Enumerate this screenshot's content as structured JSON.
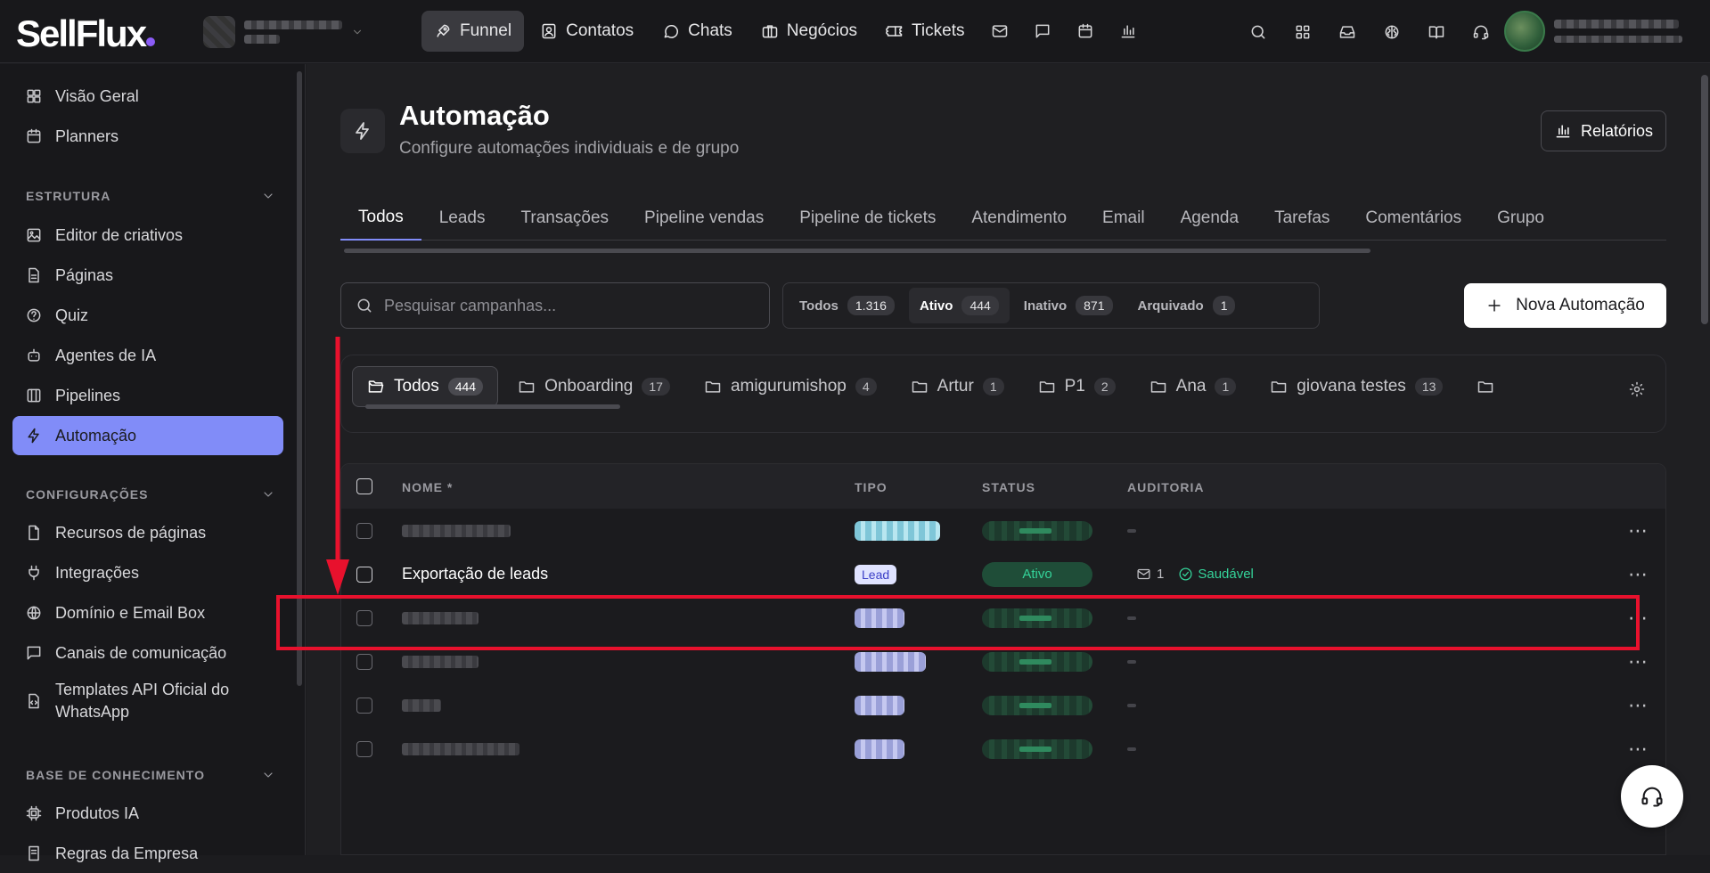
{
  "app": {
    "logo": "SellFlux"
  },
  "topnav": [
    {
      "label": "Funnel",
      "icon": "rocket-icon",
      "active": true
    },
    {
      "label": "Contatos",
      "icon": "contacts-icon"
    },
    {
      "label": "Chats",
      "icon": "chat-icon"
    },
    {
      "label": "Negócios",
      "icon": "briefcase-icon"
    },
    {
      "label": "Tickets",
      "icon": "ticket-icon"
    }
  ],
  "sidebar": {
    "top_items": [
      {
        "label": "Visão Geral",
        "icon": "dashboard-icon"
      },
      {
        "label": "Planners",
        "icon": "calendar-icon"
      }
    ],
    "sections": {
      "estrutura": "ESTRUTURA",
      "configuracoes": "CONFIGURAÇÕES",
      "base": "BASE DE CONHECIMENTO"
    },
    "estrutura_items": [
      {
        "label": "Editor de criativos",
        "icon": "image-edit-icon"
      },
      {
        "label": "Páginas",
        "icon": "page-icon"
      },
      {
        "label": "Quiz",
        "icon": "help-circle-icon"
      },
      {
        "label": "Agentes de IA",
        "icon": "bot-icon"
      },
      {
        "label": "Pipelines",
        "icon": "pipeline-icon"
      },
      {
        "label": "Automação",
        "icon": "zap-icon",
        "active": true
      }
    ],
    "config_items": [
      {
        "label": "Recursos de páginas",
        "icon": "file-icon"
      },
      {
        "label": "Integrações",
        "icon": "plug-icon"
      },
      {
        "label": "Domínio e Email Box",
        "icon": "globe-icon"
      },
      {
        "label": "Canais de comunicação",
        "icon": "message-square-icon"
      },
      {
        "label_line1": "Templates API Oficial do",
        "label_line2": "WhatsApp",
        "icon": "file-code-icon"
      }
    ],
    "base_items": [
      {
        "label": "Produtos IA",
        "icon": "cpu-icon"
      },
      {
        "label": "Regras da Empresa",
        "icon": "rules-icon"
      }
    ]
  },
  "page": {
    "title": "Automação",
    "subtitle": "Configure automações individuais e de grupo",
    "reports_button": "Relatórios"
  },
  "tabs": [
    "Todos",
    "Leads",
    "Transações",
    "Pipeline vendas",
    "Pipeline de tickets",
    "Atendimento",
    "Email",
    "Agenda",
    "Tarefas",
    "Comentários",
    "Grupo"
  ],
  "search": {
    "placeholder": "Pesquisar campanhas..."
  },
  "status_filter": [
    {
      "label": "Todos",
      "count": "1.316"
    },
    {
      "label": "Ativo",
      "count": "444",
      "active": true
    },
    {
      "label": "Inativo",
      "count": "871"
    },
    {
      "label": "Arquivado",
      "count": "1"
    }
  ],
  "new_button": "Nova Automação",
  "folders": [
    {
      "label": "Todos",
      "count": "444",
      "active": true
    },
    {
      "label": "Onboarding",
      "count": "17"
    },
    {
      "label": "amigurumishop",
      "count": "4"
    },
    {
      "label": "Artur",
      "count": "1"
    },
    {
      "label": "P1",
      "count": "2"
    },
    {
      "label": "Ana",
      "count": "1"
    },
    {
      "label": "giovana testes",
      "count": "13"
    }
  ],
  "table": {
    "headers": {
      "name": "NOME *",
      "type": "TIPO",
      "status": "STATUS",
      "audit": "AUDITORIA"
    },
    "highlighted_row": {
      "name": "Exportação de leads",
      "type": "Lead",
      "status": "Ativo",
      "audit_count": "1",
      "audit_health": "Saudável"
    }
  },
  "colors": {
    "accent": "#818cf8",
    "highlight": "#e8112d",
    "success": "#34d399"
  }
}
